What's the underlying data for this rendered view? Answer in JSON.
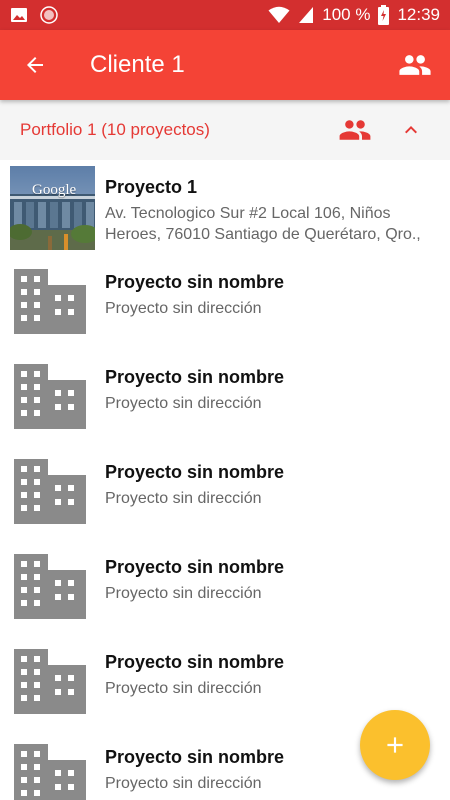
{
  "status_bar": {
    "battery": "100 %",
    "time": "12:39"
  },
  "app_bar": {
    "title": "Cliente 1"
  },
  "portfolio": {
    "title": "Portfolio 1 (10 proyectos)"
  },
  "projects": [
    {
      "name": "Proyecto 1",
      "address": "Av. Tecnologico Sur #2 Local 106, Niños Heroes, 76010 Santiago de Querétaro, Qro.,",
      "image_text": "Google"
    },
    {
      "name": "Proyecto sin nombre",
      "address": "Proyecto sin dirección"
    },
    {
      "name": "Proyecto sin nombre",
      "address": "Proyecto sin dirección"
    },
    {
      "name": "Proyecto sin nombre",
      "address": "Proyecto sin dirección"
    },
    {
      "name": "Proyecto sin nombre",
      "address": "Proyecto sin dirección"
    },
    {
      "name": "Proyecto sin nombre",
      "address": "Proyecto sin dirección"
    },
    {
      "name": "Proyecto sin nombre",
      "address": "Proyecto sin dirección"
    }
  ],
  "icons": {
    "back": "arrow-back-icon",
    "people": "people-icon",
    "group": "group-icon",
    "collapse": "chevron-up-icon",
    "building": "building-icon",
    "add": "plus-icon"
  },
  "colors": {
    "status_bar": "#d32f2f",
    "app_bar": "#f44336",
    "accent_text": "#e53935",
    "fab": "#fbc02d",
    "placeholder_icon": "#8a8a8a"
  }
}
